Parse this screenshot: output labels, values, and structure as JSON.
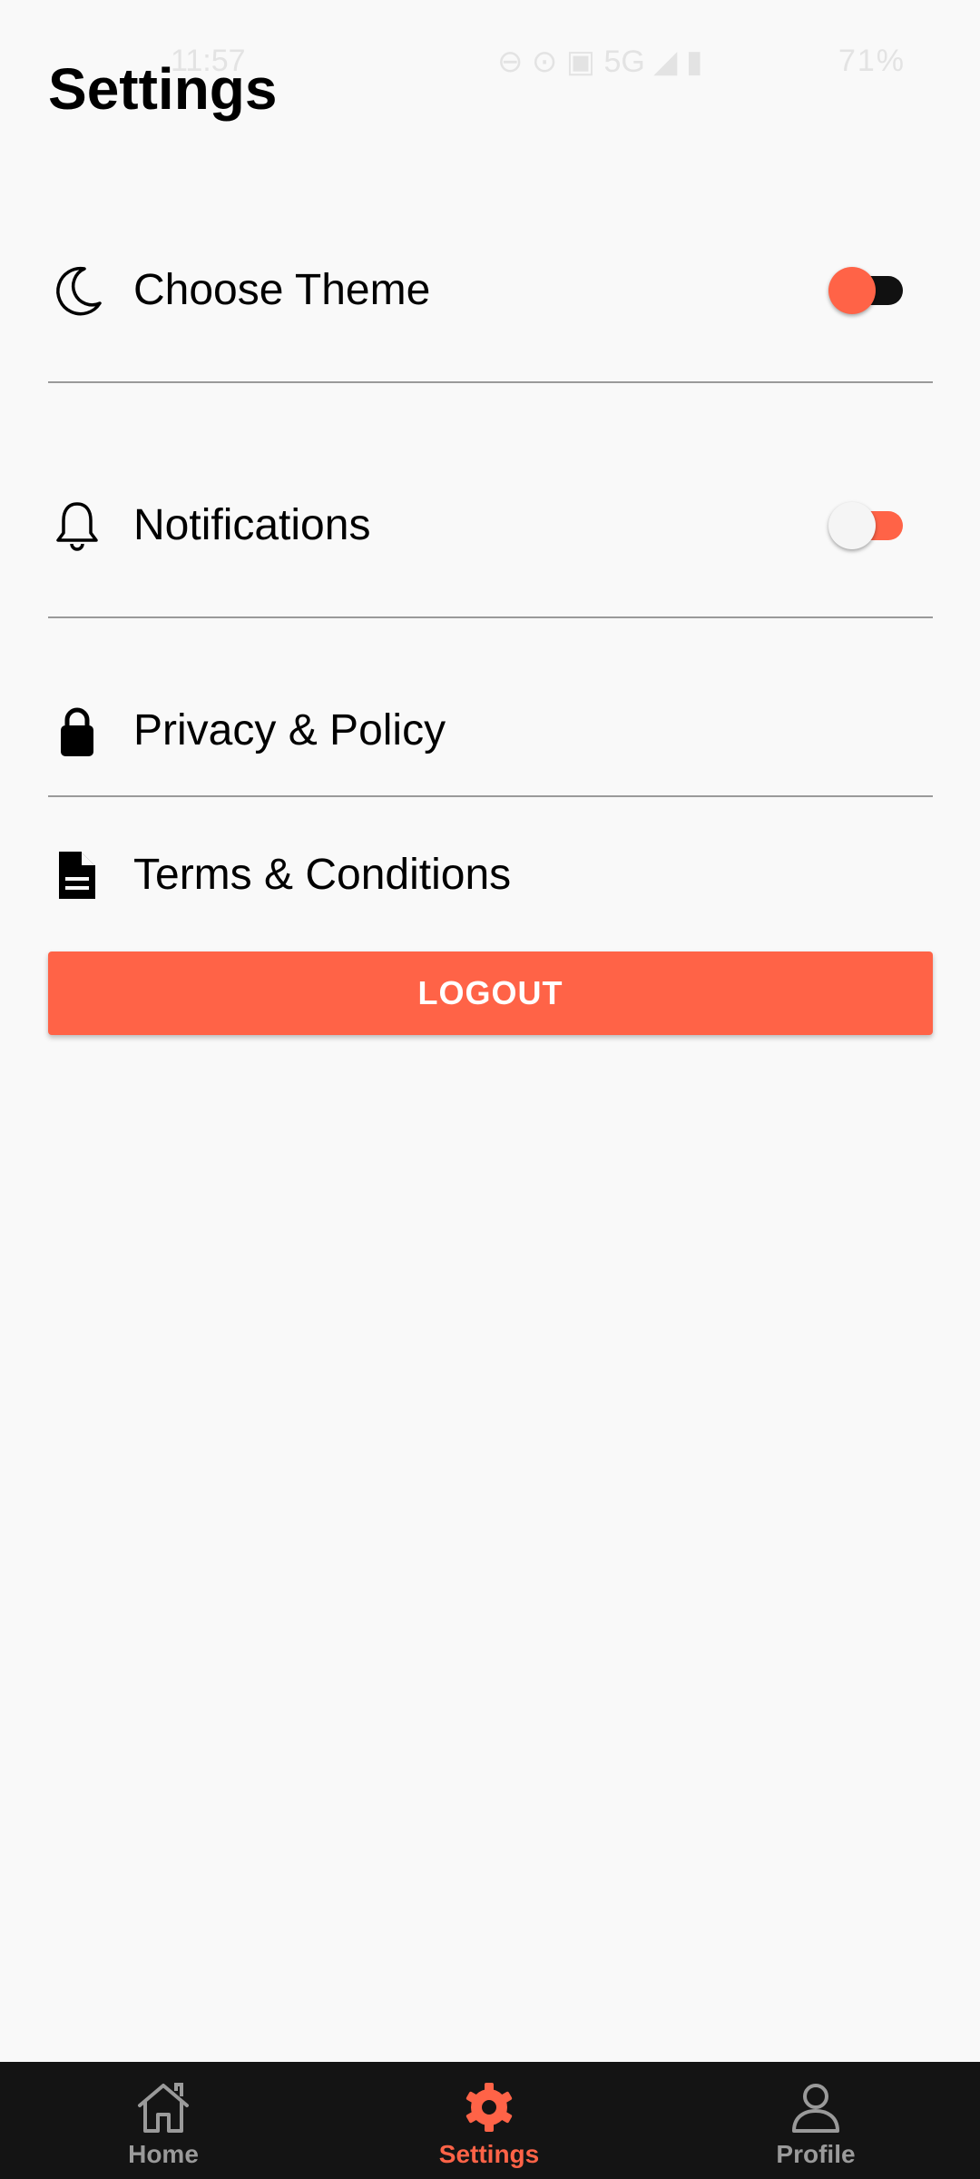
{
  "status_bar": {
    "time": "11:57",
    "battery": "71%",
    "network": "5G"
  },
  "page": {
    "title": "Settings"
  },
  "settings": {
    "theme": {
      "label": "Choose Theme",
      "icon": "moon-icon",
      "toggle_on": true
    },
    "notifications": {
      "label": "Notifications",
      "icon": "bell-icon",
      "toggle_on": false
    },
    "privacy": {
      "label": "Privacy & Policy",
      "icon": "lock-icon"
    },
    "terms": {
      "label": "Terms & Conditions",
      "icon": "document-icon"
    }
  },
  "logout": {
    "label": "LOGOUT"
  },
  "bottom_nav": {
    "items": [
      {
        "label": "Home",
        "icon": "home-icon",
        "active": false
      },
      {
        "label": "Settings",
        "icon": "gear-icon",
        "active": true
      },
      {
        "label": "Profile",
        "icon": "profile-icon",
        "active": false
      }
    ]
  },
  "colors": {
    "accent": "#ff6347",
    "background": "#f9f9f9",
    "nav_background": "#141414",
    "nav_inactive": "#9a9a9a",
    "toggle_on_track": "#111111",
    "toggle_off_thumb": "#f5f5f5"
  }
}
